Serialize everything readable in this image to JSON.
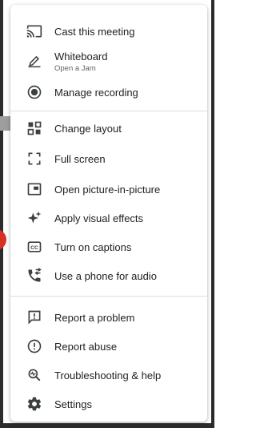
{
  "menu": {
    "items": [
      {
        "label": "Cast this meeting",
        "icon": "cast-icon"
      },
      {
        "label": "Whiteboard",
        "sublabel": "Open a Jam",
        "icon": "whiteboard-pen-icon"
      },
      {
        "label": "Manage recording",
        "icon": "record-icon"
      },
      {
        "label": "Change layout",
        "icon": "layout-icon"
      },
      {
        "label": "Full screen",
        "icon": "fullscreen-icon"
      },
      {
        "label": "Open picture-in-picture",
        "icon": "picture-in-picture-icon"
      },
      {
        "label": "Apply visual effects",
        "icon": "sparkle-icon"
      },
      {
        "label": "Turn on captions",
        "icon": "captions-icon"
      },
      {
        "label": "Use a phone for audio",
        "icon": "phone-audio-icon"
      },
      {
        "label": "Report a problem",
        "icon": "report-problem-icon"
      },
      {
        "label": "Report abuse",
        "icon": "report-abuse-icon"
      },
      {
        "label": "Troubleshooting & help",
        "icon": "troubleshoot-icon"
      },
      {
        "label": "Settings",
        "icon": "settings-gear-icon"
      }
    ]
  },
  "colors": {
    "text": "#202124",
    "icon": "#3c4043",
    "divider": "#dadce0",
    "accent": "#d93025"
  }
}
